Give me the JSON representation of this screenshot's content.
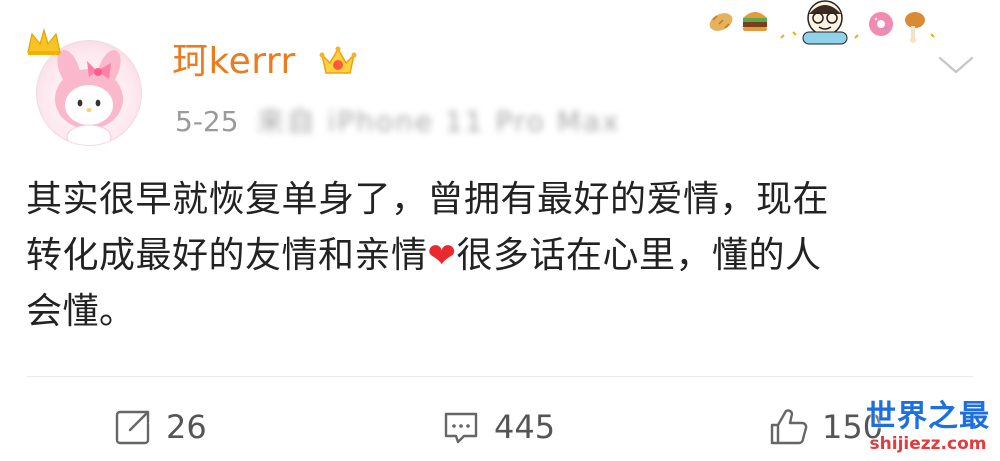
{
  "post": {
    "author": {
      "name": "珂kerrr",
      "avatar_icon": "my-melody-avatar-icon",
      "badge_icon": "vip-crown-icon",
      "avatar_badge_icon": "crown-icon"
    },
    "meta": {
      "time": "5-25",
      "device": "来自 iPhone 11 Pro Max"
    },
    "content": {
      "line1": "其实很早就恢复单身了，曾拥有最好的爱情，现在",
      "line2a": "转化成最好的友情和亲情",
      "heart": "❤",
      "line2b": "很多话在心里，懂的人",
      "line3": "会懂。"
    },
    "actions": {
      "repost_count": "26",
      "comment_count": "445",
      "like_count": "150"
    },
    "decorations": {
      "sticker_row": "food-stickers-icon",
      "menu": "chevron-down-icon"
    }
  },
  "watermark": {
    "cn": "世界之最",
    "url": "shijiezz.com"
  },
  "colors": {
    "username": "#ee7a1e",
    "meta": "#9a9a9a",
    "text": "#222222",
    "heart": "#e8292f",
    "watermark_cn": "#1d6fe0",
    "watermark_url": "#e83a3a"
  }
}
